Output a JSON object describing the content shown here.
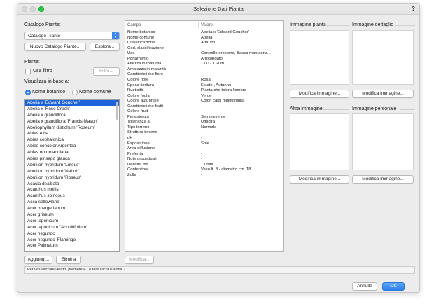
{
  "window": {
    "title": "Selezione Dati Pianta",
    "help": "?"
  },
  "catalog": {
    "label": "Catalogo Piante:",
    "selected": "Catalogo Piante",
    "new_button": "Nuovo Catalogo Piante...",
    "browse_button": "Esplora..."
  },
  "plants": {
    "label": "Piante:",
    "filter_checkbox": "Usa filtro",
    "filter_button": "Filtro...",
    "view_by_label": "Visualizza in base a:",
    "radio_botanical": "Nome botanico",
    "radio_common": "Nome comune",
    "items": [
      "Abelia x 'Edward Goucher'",
      "Abelia x 'Rose Creek'",
      "Abelia x grandiflora",
      "Abelia x grandiflora 'Francis Mason'",
      "Abeliophyllum distichum 'Roseum'",
      "Abies Alba",
      "Abies cephalonica",
      "Abies concolor Argentea",
      "Abies nordmanniana",
      "Abies pinsapo glauca",
      "Abutilon hybridum 'Luteus'",
      "Abutilon hybridum 'Nabob'",
      "Abutilon hybridum 'Roseus'",
      "Acacia dealbata",
      "Acanthus mollis",
      "Acanthus spinosus",
      "Acca sellowiana",
      "Acer buergerianum",
      "Acer griseum",
      "Acer japonicum",
      "Acer japonicum `Aconitifolium`",
      "Acer negundo",
      "Acer negundo 'Flamingo'",
      "Acer Palmatum"
    ],
    "add_button": "Aggiungi...",
    "delete_button": "Elimina"
  },
  "table": {
    "col_field": "Campo",
    "col_value": "Valore",
    "rows": [
      {
        "field": "Nome botanico",
        "value": "Abelia x 'Edward Goucher'"
      },
      {
        "field": "Nome comune",
        "value": "Abelia"
      },
      {
        "field": "Classificazione",
        "value": "Arbusto"
      },
      {
        "field": "Cod. classificazione",
        "value": "-"
      },
      {
        "field": "Uso",
        "value": "Controllo erosione, Bassa manutenz..."
      },
      {
        "field": "Portamento",
        "value": "Arrotondato"
      },
      {
        "field": "Altezza in maturità",
        "value": "1.00 - 1.20m"
      },
      {
        "field": "Ampiezza in maturità",
        "value": "-"
      },
      {
        "field": "Caratteristiche fiore",
        "value": "-"
      },
      {
        "field": "Colore fiore",
        "value": "Rosa"
      },
      {
        "field": "Epoca fioritura",
        "value": "Estate , Autunno"
      },
      {
        "field": "Rusticità",
        "value": "Pianta che tolera l'ombra"
      },
      {
        "field": "Colore foglia",
        "value": "Verde"
      },
      {
        "field": "Colore autunnale",
        "value": "Colori caldi multitonalità"
      },
      {
        "field": "Caratteristiche frutti",
        "value": "-"
      },
      {
        "field": "Colore frutti",
        "value": "-"
      },
      {
        "field": "Persistenza",
        "value": "Sempreverde"
      },
      {
        "field": "Tolleranza a",
        "value": "Umidità"
      },
      {
        "field": "Tipo terreno",
        "value": "Normale"
      },
      {
        "field": "Struttura terreno",
        "value": "-"
      },
      {
        "field": "pH",
        "value": "-"
      },
      {
        "field": "Esposizione",
        "value": "Sole"
      },
      {
        "field": "Area diffusione",
        "value": "-"
      },
      {
        "field": "Preferita",
        "value": "-"
      },
      {
        "field": "Note progettuali",
        "value": "-"
      },
      {
        "field": "Densità mq",
        "value": "1 unità"
      },
      {
        "field": "Contenitore",
        "value": "Vaso lt. 3 - diametro cm. 18"
      },
      {
        "field": "Zolla",
        "value": "-"
      }
    ],
    "modify_button": "Modifica..."
  },
  "images": {
    "plant_title": "Immagine pianta",
    "detail_title": "Immagine dettaglio",
    "other_title": "Altra immagine",
    "personal_title": "Immagine personale",
    "modify_button": "Modifica immagine..."
  },
  "status": "Per visualizzare l'Aiuto, premere F1 o fare clic sull'icona ?",
  "footer": {
    "cancel_button": "Annulla",
    "ok_button": "OK"
  },
  "colors": {
    "accent": "#3b87f1",
    "selection": "#1c62d8"
  }
}
